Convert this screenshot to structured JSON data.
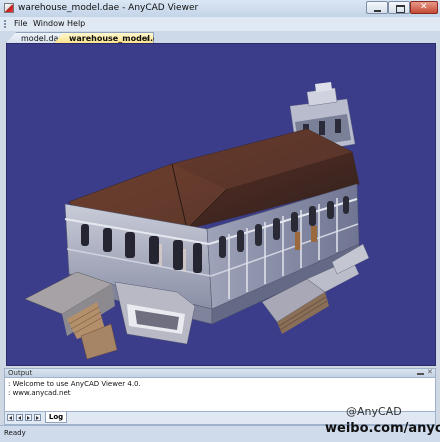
{
  "window": {
    "title": "warehouse_model.dae - AnyCAD Viewer",
    "icon": "app-icon"
  },
  "menu": {
    "items": [
      "File",
      "Window",
      "Help"
    ]
  },
  "tabs": {
    "items": [
      {
        "label": "model.dae",
        "active": false
      },
      {
        "label": "warehouse_model.dae",
        "active": true
      }
    ],
    "close_glyph": "x"
  },
  "viewport": {
    "background_color": "#3b3c8a",
    "content": "3d-building-model"
  },
  "output": {
    "title": "Output",
    "lines": [
      ": Welcome to use AnyCAD Viewer 4.0.",
      ": www.anycad.net"
    ],
    "log_tab": "Log"
  },
  "status": {
    "text": "Ready"
  },
  "watermark": {
    "line1": "@AnyCAD",
    "line2": "weibo.com/anycad"
  }
}
